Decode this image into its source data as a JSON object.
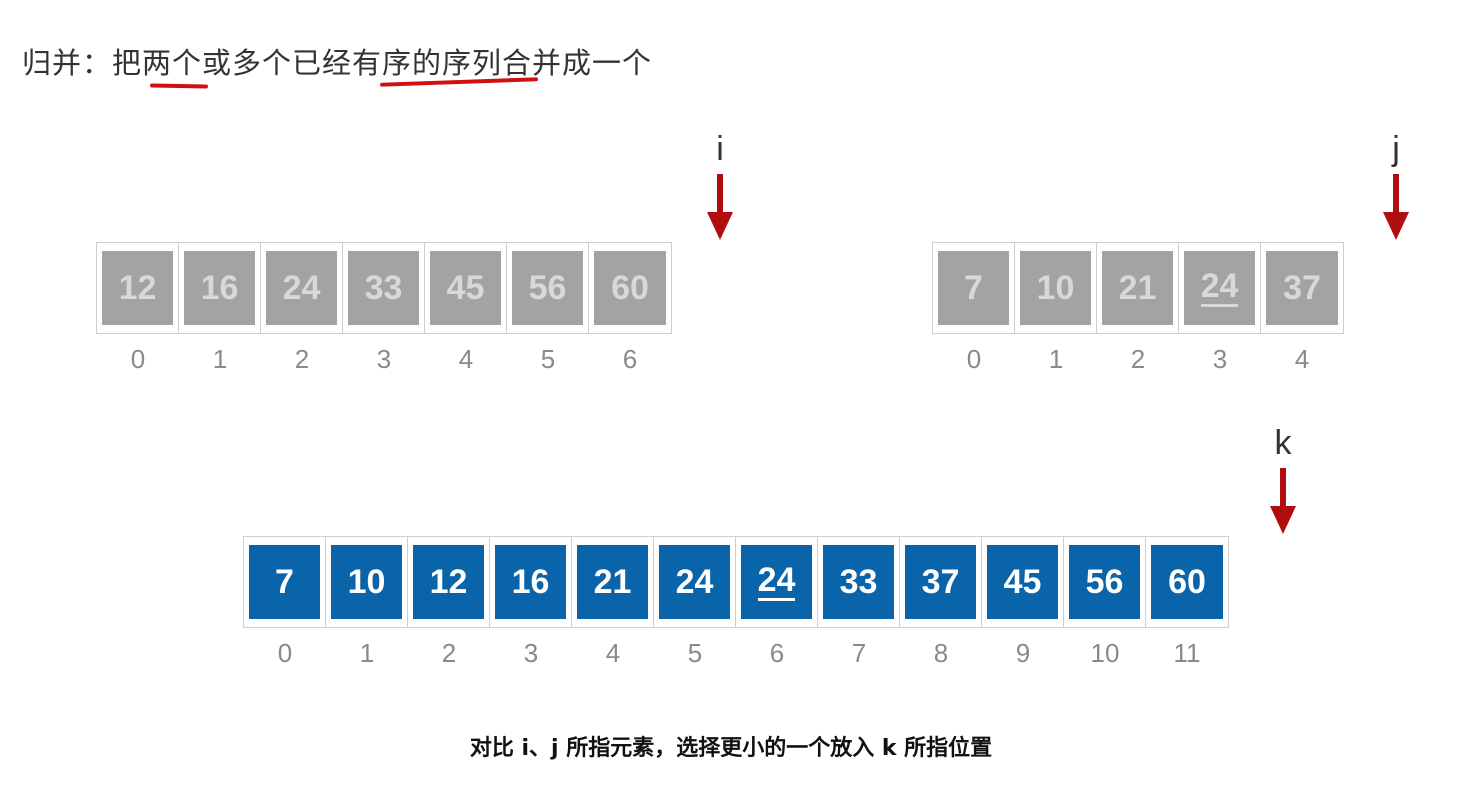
{
  "title": "归并：把两个或多个已经有序的序列合并成一个",
  "arrays": {
    "left": {
      "pointer": "i",
      "values": [
        "12",
        "16",
        "24",
        "33",
        "45",
        "56",
        "60"
      ],
      "indices": [
        "0",
        "1",
        "2",
        "3",
        "4",
        "5",
        "6"
      ]
    },
    "right": {
      "pointer": "j",
      "values": [
        "7",
        "10",
        "21",
        "24",
        "37"
      ],
      "indices": [
        "0",
        "1",
        "2",
        "3",
        "4"
      ]
    },
    "merged": {
      "pointer": "k",
      "values": [
        "7",
        "10",
        "12",
        "16",
        "21",
        "24",
        "24",
        "33",
        "37",
        "45",
        "56",
        "60"
      ],
      "indices": [
        "0",
        "1",
        "2",
        "3",
        "4",
        "5",
        "6",
        "7",
        "8",
        "9",
        "10",
        "11"
      ]
    }
  },
  "caption": "对比 i、j 所指元素，选择更小的一个放入 k 所指位置",
  "colors": {
    "gray_cell": "#a3a3a3",
    "blue_cell": "#0a64aa",
    "arrow": "#b00e0e",
    "underline": "#d10f0f"
  }
}
